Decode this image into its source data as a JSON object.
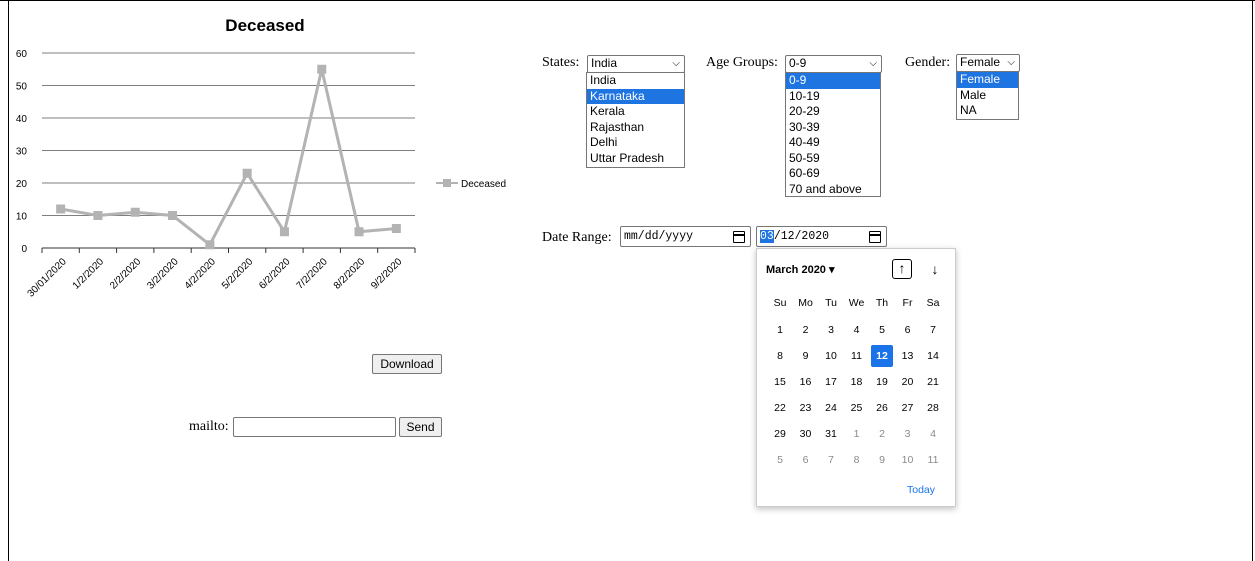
{
  "chart_data": {
    "type": "line",
    "title": "Deceased",
    "categories": [
      "30/01/2020",
      "1/2/2020",
      "2/2/2020",
      "3/2/2020",
      "4/2/2020",
      "5/2/2020",
      "6/2/2020",
      "7/2/2020",
      "8/2/2020",
      "9/2/2020"
    ],
    "series": [
      {
        "name": "Deceased",
        "values": [
          12,
          10,
          11,
          10,
          1,
          23,
          5,
          55,
          5,
          6
        ],
        "color": "#b3b3b3"
      }
    ],
    "ylim": [
      0,
      60
    ],
    "yticks": [
      "0",
      "10",
      "20",
      "30",
      "40",
      "50",
      "60"
    ],
    "grid": true,
    "legend": "right"
  },
  "download_label": "Download",
  "mailto": {
    "label": "mailto:",
    "value": "",
    "send_label": "Send"
  },
  "filters": {
    "states": {
      "label": "States:",
      "selected": "India",
      "options": [
        "India",
        "Karnataka",
        "Kerala",
        "Rajasthan",
        "Delhi",
        "Uttar Pradesh"
      ],
      "highlighted": "Karnataka"
    },
    "age_groups": {
      "label": "Age Groups:",
      "selected": "0-9",
      "options": [
        "0-9",
        "10-19",
        "20-29",
        "30-39",
        "40-49",
        "50-59",
        "60-69",
        "70 and above"
      ],
      "highlighted": "0-9"
    },
    "gender": {
      "label": "Gender:",
      "selected": "Female",
      "options": [
        "Female",
        "Male",
        "NA"
      ],
      "highlighted": "Female"
    }
  },
  "date_range": {
    "label": "Date Range:",
    "start_placeholder": "mm/dd/yyyy",
    "end_month_segment": "03",
    "end_rest": "/12/2020"
  },
  "calendar": {
    "month_label": "March 2020 ▾",
    "up_arrow": "↑",
    "down_arrow": "↓",
    "weekdays": [
      "Su",
      "Mo",
      "Tu",
      "We",
      "Th",
      "Fr",
      "Sa"
    ],
    "weeks": [
      [
        "1",
        "2",
        "3",
        "4",
        "5",
        "6",
        "7"
      ],
      [
        "8",
        "9",
        "10",
        "11",
        "12",
        "13",
        "14"
      ],
      [
        "15",
        "16",
        "17",
        "18",
        "19",
        "20",
        "21"
      ],
      [
        "22",
        "23",
        "24",
        "25",
        "26",
        "27",
        "28"
      ],
      [
        "29",
        "30",
        "31",
        "1",
        "2",
        "3",
        "4"
      ],
      [
        "5",
        "6",
        "7",
        "8",
        "9",
        "10",
        "11"
      ]
    ],
    "selected_day": "12",
    "today_label": "Today"
  },
  "colors": {
    "accent": "#1a73e8",
    "series": "#b3b3b3",
    "grid": "#7f7f7f"
  }
}
